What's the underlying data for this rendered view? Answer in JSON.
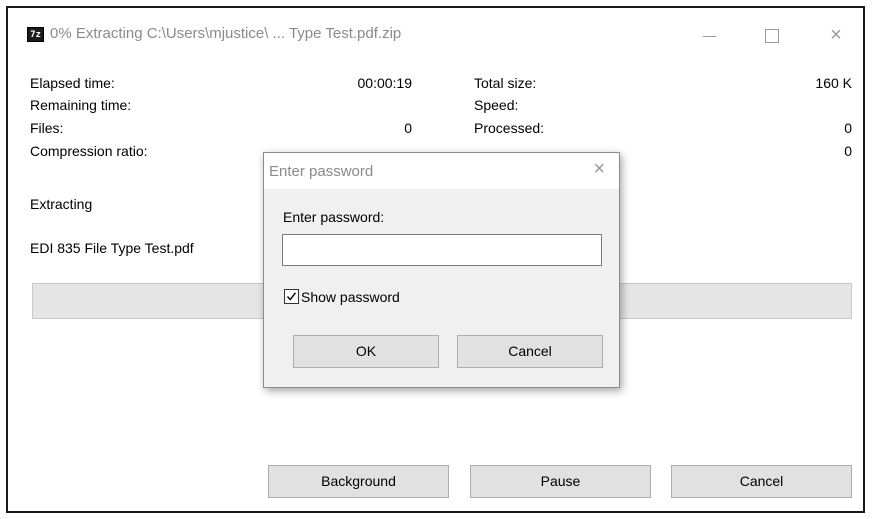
{
  "window": {
    "icon_text": "7z",
    "title": "0% Extracting C:\\Users\\mjustice\\ ...  Type Test.pdf.zip",
    "minimize": "minimize",
    "maximize": "maximize",
    "close": "×"
  },
  "stats": {
    "elapsed_label": "Elapsed time:",
    "elapsed_value": "00:00:19",
    "remaining_label": "Remaining time:",
    "files_label": "Files:",
    "files_value": "0",
    "compression_label": "Compression ratio:",
    "total_size_label": "Total size:",
    "total_size_value": "160 K",
    "speed_label": "Speed:",
    "processed_label": "Processed:",
    "processed_value": "0",
    "ratio_value": "0"
  },
  "status": {
    "action": "Extracting",
    "filename": "EDI 835 File Type Test.pdf"
  },
  "progress": {
    "percent": 0,
    "color": "#06b025"
  },
  "buttons": {
    "background": "Background",
    "pause": "Pause",
    "cancel": "Cancel"
  },
  "password_dialog": {
    "title": "Enter password",
    "close": "×",
    "label": "Enter password:",
    "value": "",
    "show_password_label": "Show password",
    "show_password_checked": true,
    "ok": "OK",
    "cancel": "Cancel"
  }
}
